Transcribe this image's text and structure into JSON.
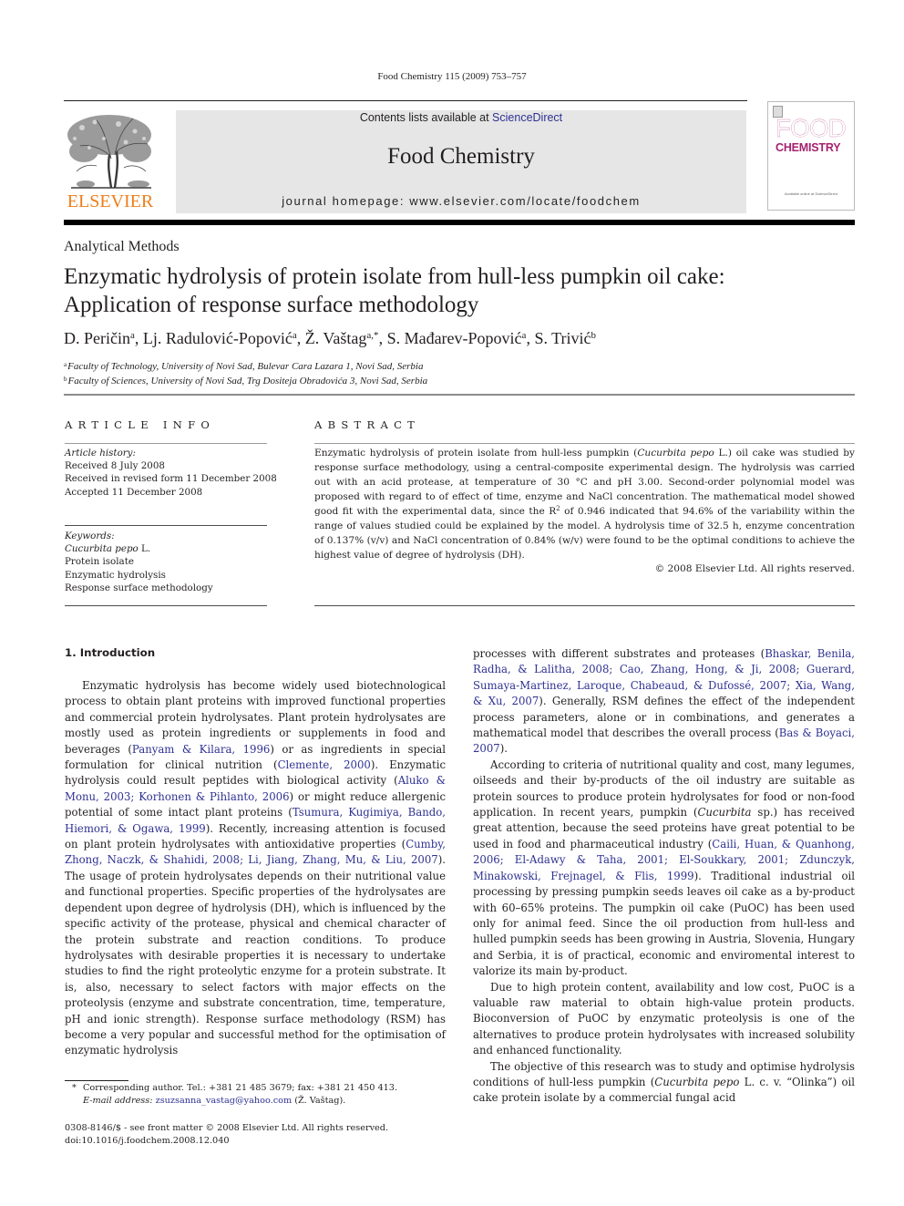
{
  "running_head": "Food Chemistry 115 (2009) 753–757",
  "header": {
    "publisher_logo": "elsevier-tree-icon",
    "publisher_wordmark": "ELSEVIER",
    "contents_prefix": "Contents lists available at ",
    "contents_link": "ScienceDirect",
    "journal_title": "Food Chemistry",
    "homepage": "journal homepage: www.elsevier.com/locate/foodchem",
    "cover": {
      "title_line1": "FOOD",
      "title_line2": "CHEMISTRY",
      "publisher_text": "Available online at ScienceDirect"
    }
  },
  "colors": {
    "link": "#2e3192",
    "elsevier_orange": "#ef7f1a",
    "cover_magenta": "#a4236e",
    "banner_gray": "#e6e6e6"
  },
  "article": {
    "section": "Analytical Methods",
    "title_line1": "Enzymatic hydrolysis of protein isolate from hull-less pumpkin oil cake:",
    "title_line2": "Application of response surface methodology",
    "authors": [
      {
        "name": "D. Peričin",
        "sup": "a"
      },
      {
        "name": "Lj. Radulović-Popović",
        "sup": "a"
      },
      {
        "name": "Ž. Vaštag",
        "sup": "a,*"
      },
      {
        "name": "S. Mađarev-Popović",
        "sup": "a"
      },
      {
        "name": "S. Trivić",
        "sup": "b"
      }
    ],
    "affiliations": [
      {
        "mark": "a",
        "text": "Faculty of Technology, University of Novi Sad, Bulevar Cara Lazara 1, Novi Sad, Serbia"
      },
      {
        "mark": "b",
        "text": "Faculty of Sciences, University of Novi Sad, Trg Dositeja Obradovića 3, Novi Sad, Serbia"
      }
    ]
  },
  "article_info": {
    "heading": "ARTICLE INFO",
    "history_label": "Article history:",
    "history": [
      "Received 8 July 2008",
      "Received in revised form 11 December 2008",
      "Accepted 11 December 2008"
    ],
    "keywords_label": "Keywords:",
    "keywords": [
      {
        "italic": "Cucurbita pepo",
        "rest": " L."
      },
      {
        "italic": "",
        "rest": "Protein isolate"
      },
      {
        "italic": "",
        "rest": "Enzymatic hydrolysis"
      },
      {
        "italic": "",
        "rest": "Response surface methodology"
      }
    ]
  },
  "abstract": {
    "heading": "ABSTRACT",
    "part1": "Enzymatic hydrolysis of protein isolate from hull-less pumpkin (",
    "species": "Cucurbita pepo",
    "part2": " L.) oil cake was studied by response surface methodology, using a central-composite experimental design. The hydrolysis was carried out with an acid protease, at temperature of 30 °C and pH 3.00. Second-order polynomial model was proposed with regard to of effect of time, enzyme and NaCl concentration. The mathematical model showed good fit with the experimental data, since the R",
    "sup": "2",
    "part3": " of 0.946 indicated that 94.6% of the variability within the range of values studied could be explained by the model. A hydrolysis time of 32.5 h, enzyme concentration of 0.137% (v/v) and NaCl concentration of 0.84% (w/v) were found to be the optimal conditions to achieve the highest value of degree of hydrolysis (DH).",
    "copyright": "© 2008 Elsevier Ltd. All rights reserved."
  },
  "introduction": {
    "heading": "1. Introduction",
    "left": {
      "p1": [
        {
          "t": "Enzymatic hydrolysis has become widely used biotechnological process to obtain plant proteins with improved functional properties and commercial protein hydrolysates. Plant protein hydrolysates are mostly used as protein ingredients or supplements in food and beverages ("
        },
        {
          "link": "Panyam & Kilara, 1996"
        },
        {
          "t": ") or as ingredients in special formulation for clinical nutrition ("
        },
        {
          "link": "Clemente, 2000"
        },
        {
          "t": "). Enzymatic hydrolysis could result peptides with biological activity ("
        },
        {
          "link": "Aluko & Monu, 2003; Korhonen & Pihlanto, 2006"
        },
        {
          "t": ") or might reduce allergenic potential of some intact plant proteins ("
        },
        {
          "link": "Tsumura, Kugimiya, Bando, Hiemori, & Ogawa, 1999"
        },
        {
          "t": "). Recently, increasing attention is focused on plant protein hydrolysates with antioxidative properties ("
        },
        {
          "link": "Cumby, Zhong, Naczk, & Shahidi, 2008; Li, Jiang, Zhang, Mu, & Liu, 2007"
        },
        {
          "t": "). The usage of protein hydrolysates depends on their nutritional value and functional properties. Specific properties of the hydrolysates are dependent upon degree of hydrolysis (DH), which is influenced by the specific activity of the protease, physical and chemical character of the protein substrate and reaction conditions. To produce hydrolysates with desirable properties it is necessary to undertake studies to find the right proteolytic enzyme for a protein substrate. It is, also, necessary to select factors with major effects on the proteolysis (enzyme and substrate concentration, time, temperature, pH and ionic strength). Response surface methodology (RSM) has become a very popular and successful method for the optimisation of enzymatic hydrolysis"
        }
      ]
    },
    "right": {
      "p1_cont": [
        {
          "t": "processes with different substrates and proteases ("
        },
        {
          "link": "Bhaskar, Benila, Radha, & Lalitha, 2008; Cao, Zhang, Hong, & Ji, 2008; Guerard, Sumaya-Martinez, Laroque, Chabeaud, & Dufossé, 2007; Xia, Wang, & Xu, 2007"
        },
        {
          "t": "). Generally, RSM defines the effect of the independent process parameters, alone or in combinations, and generates a mathematical model that describes the overall process ("
        },
        {
          "link": "Bas & Boyaci, 2007"
        },
        {
          "t": ")."
        }
      ],
      "p2": [
        {
          "t": "According to criteria of nutritional quality and cost, many legumes, oilseeds and their by-products of the oil industry are suitable as protein sources to produce protein hydrolysates for food or non-food application. In recent years, pumpkin ("
        },
        {
          "i": "Cucurbita"
        },
        {
          "t": " sp.) has received great attention, because the seed proteins have great potential to be used in food and pharmaceutical industry ("
        },
        {
          "link": "Caili, Huan, & Quanhong, 2006; El-Adawy & Taha, 2001; El-Soukkary, 2001; Zdunczyk, Minakowski, Frejnagel, & Flis, 1999"
        },
        {
          "t": "). Traditional industrial oil processing by pressing pumpkin seeds leaves oil cake as a by-product with 60–65% proteins. The pumpkin oil cake (PuOC) has been used only for animal feed. Since the oil production from hull-less and hulled pumpkin seeds has been growing in Austria, Slovenia, Hungary and Serbia, it is of practical, economic and enviromental interest to valorize its main by-product."
        }
      ],
      "p3": [
        {
          "t": "Due to high protein content, availability and low cost, PuOC is a valuable raw material to obtain high-value protein products. Bioconversion of PuOC by enzymatic proteolysis is one of the alternatives to produce protein hydrolysates with increased solubility and enhanced functionality."
        }
      ],
      "p4": [
        {
          "t": "The objective of this research was to study and optimise hydrolysis conditions of hull-less pumpkin ("
        },
        {
          "i": "Cucurbita pepo"
        },
        {
          "t": " L. c. v. “Olinka”) oil cake protein isolate by a commercial fungal acid"
        }
      ]
    }
  },
  "footnotes": {
    "star": "*",
    "corresponding": "Corresponding author. Tel.: +381 21 485 3679; fax: +381 21 450 413.",
    "email_label": "E-mail address:",
    "email": "zsuzsanna_vastag@yahoo.com",
    "email_owner": " (Ž. Vaštag)."
  },
  "imprint": {
    "issn_line": "0308-8146/$ - see front matter © 2008 Elsevier Ltd. All rights reserved.",
    "doi": "doi:10.1016/j.foodchem.2008.12.040"
  }
}
